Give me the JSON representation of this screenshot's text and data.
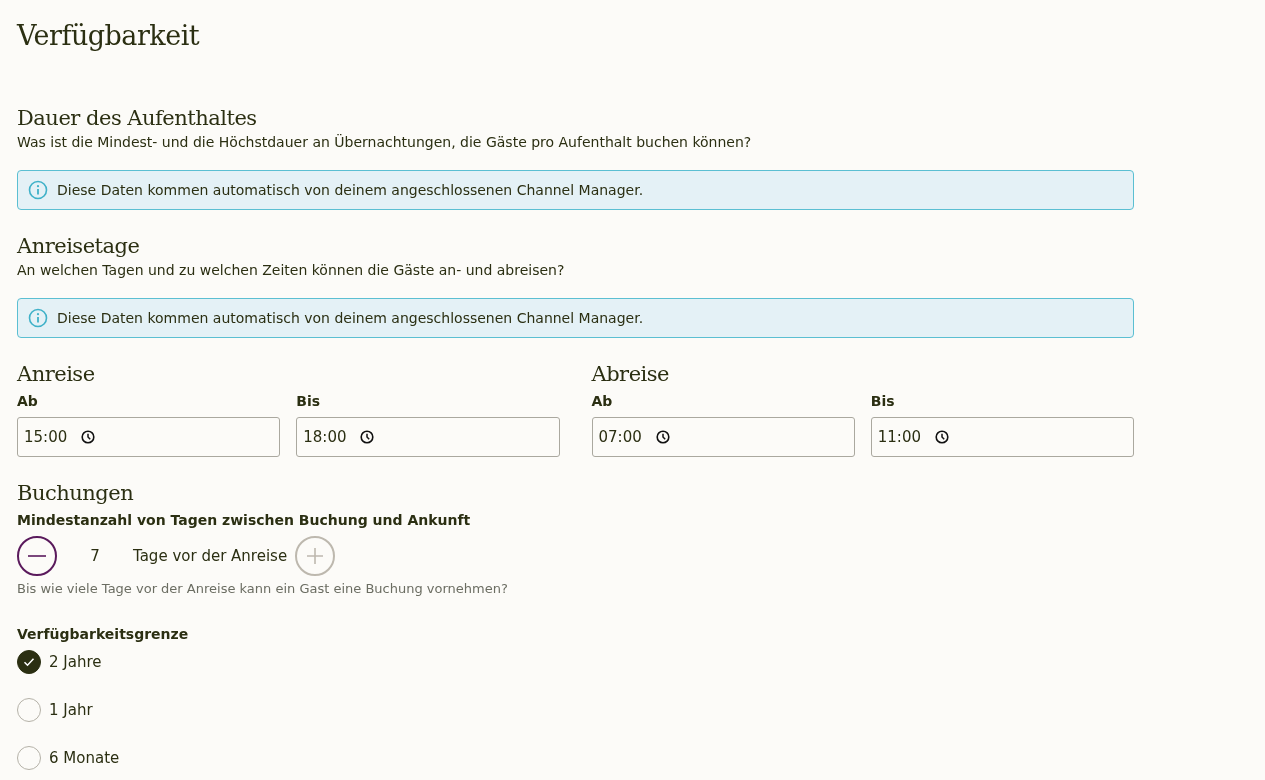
{
  "title": "Verfügbarkeit",
  "stay": {
    "heading": "Dauer des Aufenthaltes",
    "description": "Was ist die Mindest- und die Höchstdauer an Übernachtungen, die Gäste pro Aufenthalt buchen können?",
    "info": "Diese Daten kommen automatisch von deinem angeschlossenen Channel Manager."
  },
  "arrival_days": {
    "heading": "Anreisetage",
    "description": "An welchen Tagen und zu welchen Zeiten können die Gäste an- und abreisen?",
    "info": "Diese Daten kommen automatisch von deinem angeschlossenen Channel Manager."
  },
  "times": [
    {
      "heading": "Anreise",
      "fields": [
        {
          "label": "Ab",
          "value": "15:00"
        },
        {
          "label": "Bis",
          "value": "18:00"
        }
      ]
    },
    {
      "heading": "Abreise",
      "fields": [
        {
          "label": "Ab",
          "value": "07:00"
        },
        {
          "label": "Bis",
          "value": "11:00"
        }
      ]
    }
  ],
  "bookings": {
    "heading": "Buchungen",
    "label": "Mindestanzahl von Tagen zwischen Buchung und Ankunft",
    "decrement_disabled": false,
    "value": "7",
    "unit": "Tage vor der Anreise",
    "increment_disabled": true,
    "hint": "Bis wie viele Tage vor der Anreise kann ein Gast eine Buchung vornehmen?"
  },
  "limit": {
    "label": "Verfügbarkeitsgrenze",
    "options": [
      {
        "label": "2 Jahre",
        "selected": true
      },
      {
        "label": "1 Jahr",
        "selected": false
      },
      {
        "label": "6 Monate",
        "selected": false
      }
    ]
  }
}
